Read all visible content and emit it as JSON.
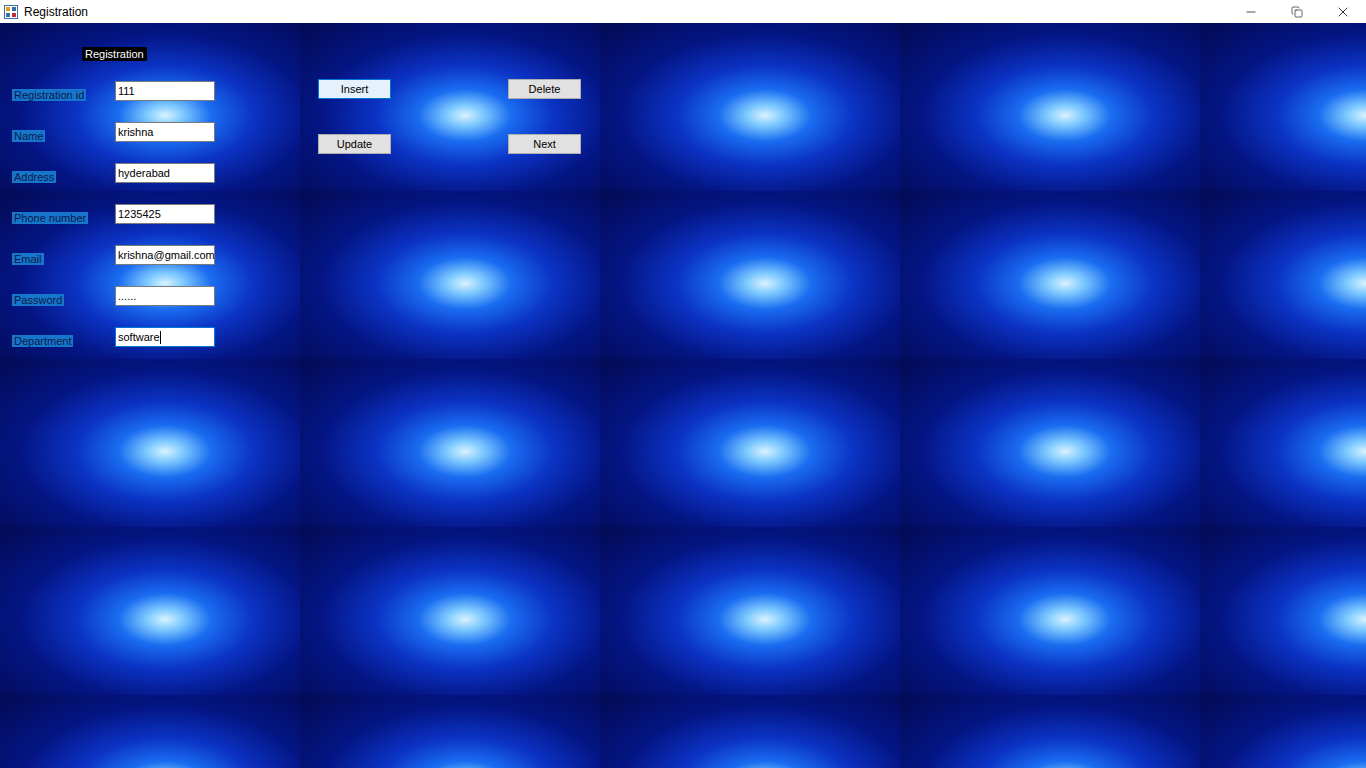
{
  "window": {
    "title": "Registration"
  },
  "heading": "Registration",
  "fields": [
    {
      "label": "Registration id",
      "value": "111",
      "focused": false
    },
    {
      "label": "Name",
      "value": "krishna",
      "focused": false
    },
    {
      "label": "Address",
      "value": "hyderabad",
      "focused": false
    },
    {
      "label": "Phone number",
      "value": "1235425",
      "focused": false
    },
    {
      "label": "Email",
      "value": "krishna@gmail.com",
      "focused": false
    },
    {
      "label": "Password",
      "value": "......",
      "focused": false
    },
    {
      "label": "Department",
      "value": "software",
      "focused": true
    }
  ],
  "buttons": [
    {
      "label": "Insert",
      "selected": true
    },
    {
      "label": "Delete",
      "selected": false
    },
    {
      "label": "Update",
      "selected": false
    },
    {
      "label": "Next",
      "selected": false
    }
  ]
}
